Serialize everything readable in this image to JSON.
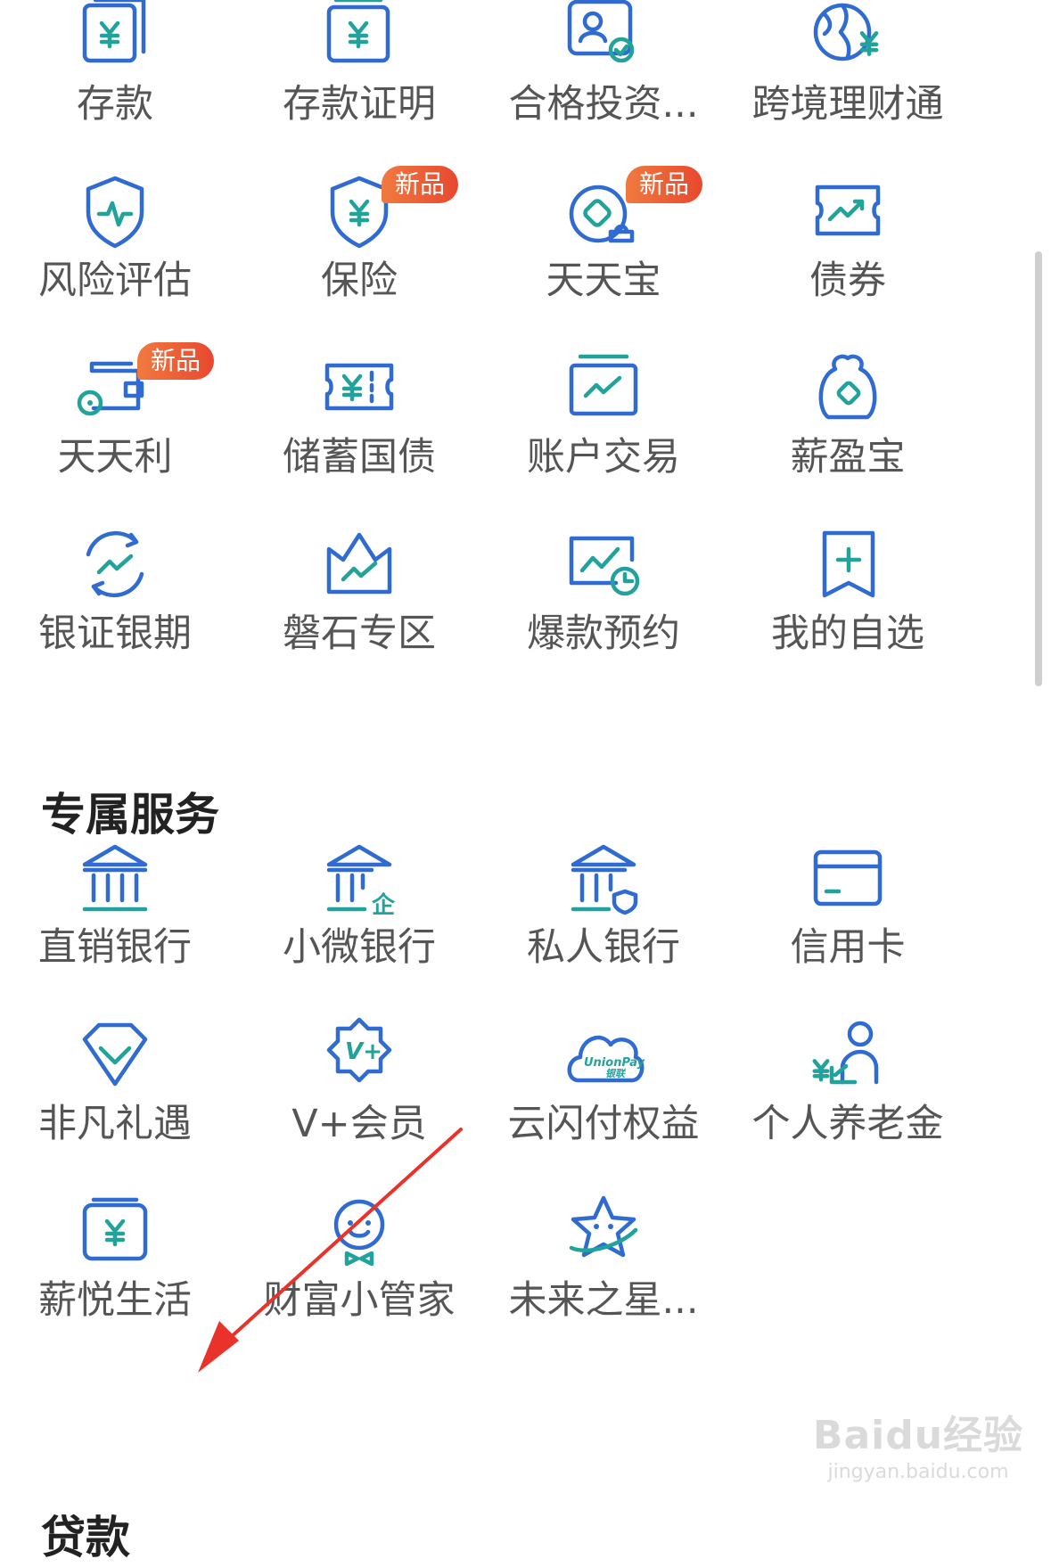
{
  "colors": {
    "icon_blue": "#2f6bd1",
    "icon_teal": "#21a39b",
    "badge": "#e8482f",
    "arrow": "#e8322a"
  },
  "finance_grid": [
    {
      "label": "存款",
      "icon": "yuan-card-icon"
    },
    {
      "label": "存款证明",
      "icon": "yuan-certificate-icon"
    },
    {
      "label": "合格投资...",
      "icon": "qualified-investor-icon"
    },
    {
      "label": "跨境理财通",
      "icon": "globe-yuan-icon"
    },
    {
      "label": "风险评估",
      "icon": "shield-pulse-icon"
    },
    {
      "label": "保险",
      "icon": "shield-yuan-icon",
      "badge": "新品"
    },
    {
      "label": "天天宝",
      "icon": "daily-treasure-icon",
      "badge": "新品"
    },
    {
      "label": "债券",
      "icon": "bond-ticket-icon"
    },
    {
      "label": "天天利",
      "icon": "wallet-coin-icon",
      "badge": "新品"
    },
    {
      "label": "储蓄国债",
      "icon": "savings-bond-icon"
    },
    {
      "label": "账户交易",
      "icon": "account-trade-icon"
    },
    {
      "label": "薪盈宝",
      "icon": "money-bag-icon"
    },
    {
      "label": "银证银期",
      "icon": "cycle-trend-icon"
    },
    {
      "label": "磐石专区",
      "icon": "crown-chart-icon"
    },
    {
      "label": "爆款预约",
      "icon": "chart-clock-icon"
    },
    {
      "label": "我的自选",
      "icon": "bookmark-plus-icon"
    }
  ],
  "section_title": "专属服务",
  "service_grid": [
    {
      "label": "直销银行",
      "icon": "bank-building-icon"
    },
    {
      "label": "小微银行",
      "icon": "bank-enterprise-icon"
    },
    {
      "label": "私人银行",
      "icon": "bank-shield-icon"
    },
    {
      "label": "信用卡",
      "icon": "credit-card-icon"
    },
    {
      "label": "非凡礼遇",
      "icon": "diamond-check-icon"
    },
    {
      "label": "V+会员",
      "icon": "v-plus-badge-icon"
    },
    {
      "label": "云闪付权益",
      "icon": "unionpay-cloud-icon"
    },
    {
      "label": "个人养老金",
      "icon": "pension-person-icon"
    },
    {
      "label": "薪悦生活",
      "icon": "salary-life-icon"
    },
    {
      "label": "财富小管家",
      "icon": "wealth-butler-icon"
    },
    {
      "label": "未来之星...",
      "icon": "future-star-icon"
    }
  ],
  "next_section_title": "贷款",
  "unionpay_text": "UnionPay",
  "unionpay_cn": "银联",
  "watermark": {
    "logo": "Baidu经验",
    "url": "jingyan.baidu.com"
  }
}
